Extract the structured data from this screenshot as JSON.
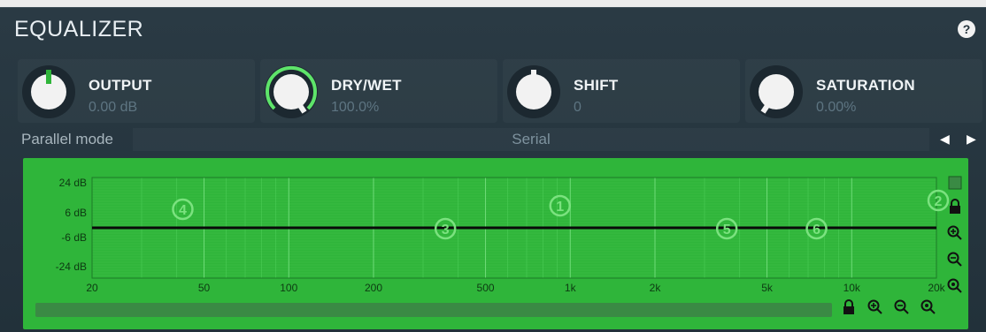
{
  "title": "EQUALIZER",
  "help_label": "?",
  "knobs": [
    {
      "label": "OUTPUT",
      "value": "0.00 dB",
      "level": 0.5
    },
    {
      "label": "DRY/WET",
      "value": "100.0%",
      "level": 1.0
    },
    {
      "label": "SHIFT",
      "value": "0",
      "level": 0.5
    },
    {
      "label": "SATURATION",
      "value": "0.00%",
      "level": 0.0
    }
  ],
  "parallel_mode": {
    "label": "Parallel mode",
    "value": "Serial",
    "prev_icon": "triangle-left-icon",
    "next_icon": "triangle-right-icon"
  },
  "graph": {
    "y_ticks": [
      "24 dB",
      "6 dB",
      "-6 dB",
      "-24 dB"
    ],
    "x_ticks": [
      "20",
      "50",
      "100",
      "200",
      "500",
      "1k",
      "2k",
      "5k",
      "10k",
      "20k"
    ],
    "band_markers": [
      "1",
      "2",
      "3",
      "4",
      "5",
      "6"
    ],
    "colors": {
      "background": "#2fb53a",
      "curve": "#0a0a0a",
      "marker": "#7be27f"
    }
  },
  "side_icons": [
    "square-icon",
    "lock-icon",
    "zoom-in-icon",
    "zoom-out-icon",
    "zoom-reset-icon"
  ],
  "bottom_icons": [
    "lock-icon",
    "zoom-in-icon",
    "zoom-out-icon",
    "zoom-reset-icon"
  ]
}
